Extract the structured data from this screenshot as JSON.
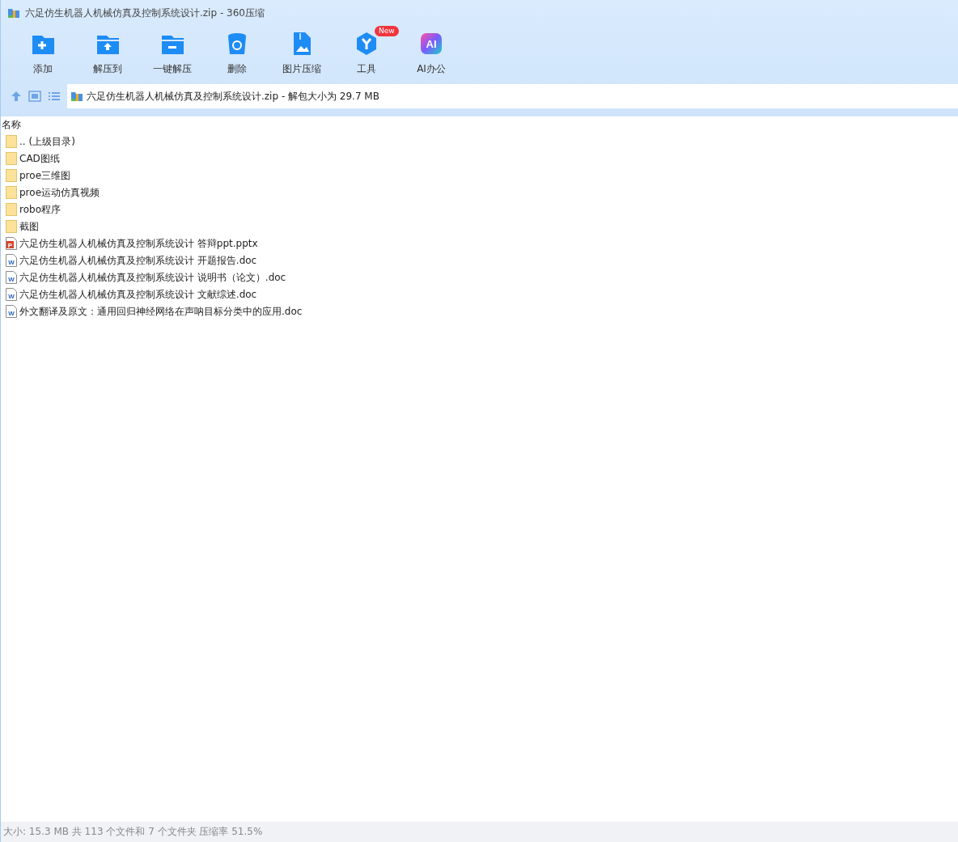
{
  "window": {
    "title": "六足仿生机器人机械仿真及控制系统设计.zip - 360压缩"
  },
  "toolbar": [
    {
      "kind": "add",
      "label": "添加"
    },
    {
      "kind": "extract-to",
      "label": "解压到"
    },
    {
      "kind": "extract",
      "label": "一键解压"
    },
    {
      "kind": "delete",
      "label": "删除"
    },
    {
      "kind": "image",
      "label": "图片压缩"
    },
    {
      "kind": "tools",
      "label": "工具",
      "badge": "New"
    },
    {
      "kind": "ai",
      "label": "AI办公",
      "icon_text": "AI"
    }
  ],
  "path_bar": {
    "text": "六足仿生机器人机械仿真及控制系统设计.zip - 解包大小为 29.7 MB"
  },
  "file_list": {
    "columns": [
      "名称"
    ],
    "rows": [
      {
        "kind": "folder",
        "name": ".. (上级目录)"
      },
      {
        "kind": "folder",
        "name": "CAD图纸"
      },
      {
        "kind": "folder",
        "name": "proe三维图"
      },
      {
        "kind": "folder",
        "name": "proe运动仿真视频"
      },
      {
        "kind": "folder",
        "name": "robo程序"
      },
      {
        "kind": "folder",
        "name": "截图"
      },
      {
        "kind": "pptx",
        "name": "六足仿生机器人机械仿真及控制系统设计 答辩ppt.pptx",
        "icon_text": "P"
      },
      {
        "kind": "doc",
        "name": "六足仿生机器人机械仿真及控制系统设计 开题报告.doc",
        "icon_text": "W"
      },
      {
        "kind": "doc",
        "name": "六足仿生机器人机械仿真及控制系统设计 说明书（论文）.doc",
        "icon_text": "W"
      },
      {
        "kind": "doc",
        "name": "六足仿生机器人机械仿真及控制系统设计 文献综述.doc",
        "icon_text": "W"
      },
      {
        "kind": "doc",
        "name": "外文翻译及原文：通用回归神经网络在声呐目标分类中的应用.doc",
        "icon_text": "W"
      }
    ]
  },
  "status_bar": {
    "text": "大小: 15.3 MB 共 113 个文件和 7 个文件夹 压缩率 51.5%"
  }
}
